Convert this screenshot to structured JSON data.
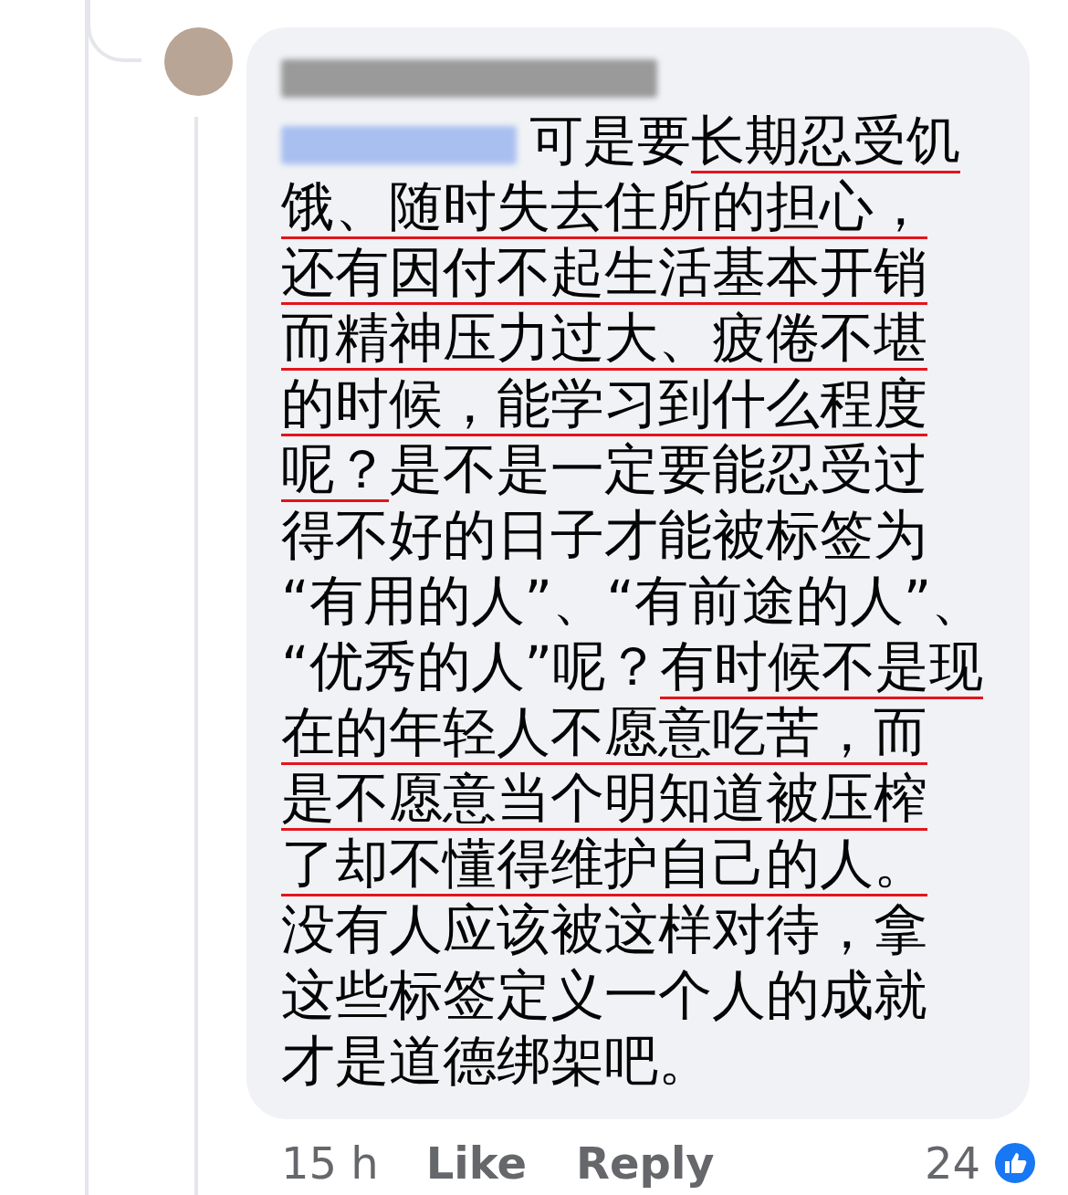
{
  "comment": {
    "author": {
      "redacted": true
    },
    "lines": [
      {
        "mention": {
          "redacted": true
        },
        "segments": [
          {
            "text": "可是要",
            "underlined": false
          },
          {
            "text": "长期忍受饥",
            "underlined": true
          }
        ]
      },
      {
        "segments": [
          {
            "text": "饿、随时失去住所的担心，",
            "underlined": true
          }
        ]
      },
      {
        "segments": [
          {
            "text": "还有因付不起生活基本开销",
            "underlined": true
          }
        ]
      },
      {
        "segments": [
          {
            "text": "而精神压力过大、疲倦不堪",
            "underlined": true
          }
        ]
      },
      {
        "segments": [
          {
            "text": "的时候，能学习到什么程度",
            "underlined": true
          }
        ]
      },
      {
        "segments": [
          {
            "text": "呢？",
            "underlined": true
          },
          {
            "text": "是不是一定要能忍受过",
            "underlined": false
          }
        ]
      },
      {
        "segments": [
          {
            "text": "得不好的日子才能被标签为",
            "underlined": false
          }
        ]
      },
      {
        "segments": [
          {
            "text": "“有用的人”、“有前途的人”、",
            "underlined": false
          }
        ]
      },
      {
        "segments": [
          {
            "text": "“优秀的人”呢？",
            "underlined": false
          },
          {
            "text": "有时候不是现",
            "underlined": true
          }
        ]
      },
      {
        "segments": [
          {
            "text": "在的年轻人不愿意吃苦，而",
            "underlined": true
          }
        ]
      },
      {
        "segments": [
          {
            "text": "是不愿意当个明知道被压榨",
            "underlined": true
          }
        ]
      },
      {
        "segments": [
          {
            "text": "了却不懂得维护自己的人。",
            "underlined": true
          }
        ]
      },
      {
        "segments": [
          {
            "text": "没有人应该被这样对待，拿",
            "underlined": false
          }
        ]
      },
      {
        "segments": [
          {
            "text": "这些标签定义一个人的成就",
            "underlined": false
          }
        ]
      },
      {
        "segments": [
          {
            "text": "才是道德绑架吧。",
            "underlined": false
          }
        ]
      }
    ],
    "time": "15 h",
    "like": "Like",
    "reply": "Reply",
    "reaction_count": "24"
  }
}
